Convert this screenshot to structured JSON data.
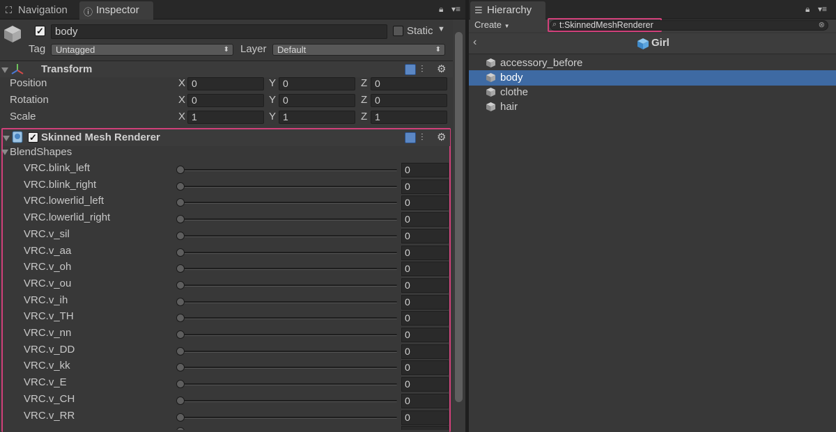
{
  "inspector_panel": {
    "tabs": [
      {
        "label": "Navigation",
        "icon": "compass-icon"
      },
      {
        "label": "Inspector",
        "icon": "info-icon"
      }
    ],
    "object": {
      "enabled": true,
      "name": "body",
      "static_label": "Static",
      "static_checked": false,
      "tag_label": "Tag",
      "tag_value": "Untagged",
      "layer_label": "Layer",
      "layer_value": "Default"
    },
    "transform": {
      "title": "Transform",
      "rows": [
        {
          "label": "Position",
          "x": "0",
          "y": "0",
          "z": "0"
        },
        {
          "label": "Rotation",
          "x": "0",
          "y": "0",
          "z": "0"
        },
        {
          "label": "Scale",
          "x": "1",
          "y": "1",
          "z": "1"
        }
      ],
      "axis_labels": [
        "X",
        "Y",
        "Z"
      ]
    },
    "skinned_mesh_renderer": {
      "title": "Skinned Mesh Renderer",
      "enabled": true,
      "blendshapes_label": "BlendShapes",
      "blendshapes": [
        {
          "name": "VRC.blink_left",
          "value": "0"
        },
        {
          "name": "VRC.blink_right",
          "value": "0"
        },
        {
          "name": "VRC.lowerlid_left",
          "value": "0"
        },
        {
          "name": "VRC.lowerlid_right",
          "value": "0"
        },
        {
          "name": "VRC.v_sil",
          "value": "0"
        },
        {
          "name": "VRC.v_aa",
          "value": "0"
        },
        {
          "name": "VRC.v_oh",
          "value": "0"
        },
        {
          "name": "VRC.v_ou",
          "value": "0"
        },
        {
          "name": "VRC.v_ih",
          "value": "0"
        },
        {
          "name": "VRC.v_TH",
          "value": "0"
        },
        {
          "name": "VRC.v_nn",
          "value": "0"
        },
        {
          "name": "VRC.v_DD",
          "value": "0"
        },
        {
          "name": "VRC.v_kk",
          "value": "0"
        },
        {
          "name": "VRC.v_E",
          "value": "0"
        },
        {
          "name": "VRC.v_CH",
          "value": "0"
        },
        {
          "name": "VRC.v_RR",
          "value": "0"
        }
      ]
    },
    "highlight_color": "#d1407a"
  },
  "hierarchy_panel": {
    "tab_label": "Hierarchy",
    "create_label": "Create",
    "search_value": "t:SkinnedMeshRenderer",
    "scene_root": "Girl",
    "items": [
      {
        "name": "accessory_before",
        "selected": false
      },
      {
        "name": "body",
        "selected": true
      },
      {
        "name": "clothe",
        "selected": false
      },
      {
        "name": "hair",
        "selected": false
      }
    ],
    "selection_color": "#3e6aa3"
  }
}
